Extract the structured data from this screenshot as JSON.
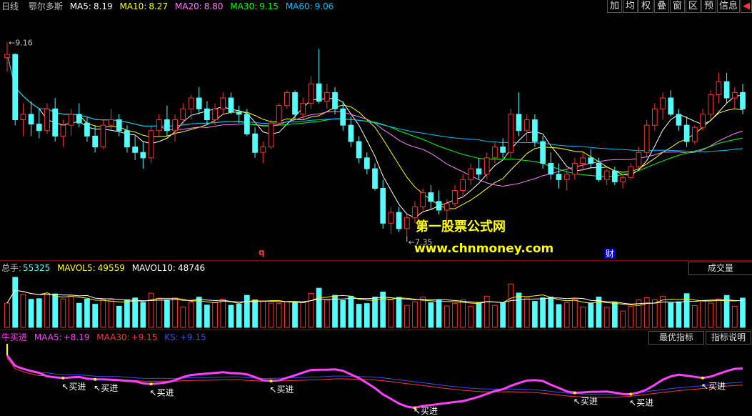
{
  "header": {
    "period": "日线",
    "stock_name": "鄂尔多斯",
    "ma5_label": "MA5:",
    "ma5": "8.19",
    "ma10_label": "MA10:",
    "ma10": "8.27",
    "ma20_label": "MA20:",
    "ma20": "8.80",
    "ma30_label": "MA30:",
    "ma30": "9.15",
    "ma60_label": "MA60:",
    "ma60": "9.06",
    "colors": {
      "ma5": "#ffffff",
      "ma10": "#ffff00",
      "ma20": "#ff80ff",
      "ma30": "#00ff00",
      "ma60": "#00c0ff"
    }
  },
  "toolbar": {
    "items": [
      "加",
      "均",
      "权",
      "叠",
      "窗",
      "区",
      "预",
      "信息"
    ],
    "arrow": "◀"
  },
  "watermark": {
    "line1": "第一股票公式网",
    "line2": "www.chnmoney.com"
  },
  "markers": {
    "q": "q",
    "cai": "财"
  },
  "volume_panel": {
    "total_label": "总手:",
    "total": "55325",
    "mavol5_label": "MAVOL5:",
    "mavol5": "49559",
    "mavol10_label": "MAVOL10:",
    "mavol10": "48746",
    "tab_label": "成交量"
  },
  "indicator_panel": {
    "name": "牛买进",
    "maa5_label": "MAA5:",
    "maa5": "+8.19",
    "maa30_label": "MAA30:",
    "maa30": "+9.15",
    "ks_label": "KS:",
    "ks": "+9.15",
    "btn_optimal": "最优指标",
    "btn_help": "指标说明",
    "signal_label": "买进"
  },
  "chart_data": {
    "type": "candlestick",
    "title": "鄂尔多斯 日线",
    "price_annotations": {
      "high": "9.16",
      "low": "7.35"
    },
    "colors": {
      "up": "#ff3232",
      "down": "#54fcfc",
      "signal": "#ffff00"
    },
    "candles": [
      [
        9.02,
        9.16,
        8.89,
        9.05
      ],
      [
        9.05,
        9.06,
        8.4,
        8.45
      ],
      [
        8.45,
        8.6,
        8.3,
        8.5
      ],
      [
        8.5,
        8.62,
        8.3,
        8.41
      ],
      [
        8.41,
        8.55,
        8.28,
        8.35
      ],
      [
        8.35,
        8.6,
        8.32,
        8.55
      ],
      [
        8.55,
        8.65,
        8.25,
        8.3
      ],
      [
        8.3,
        8.45,
        8.2,
        8.4
      ],
      [
        8.4,
        8.55,
        8.3,
        8.5
      ],
      [
        8.5,
        8.6,
        8.38,
        8.42
      ],
      [
        8.42,
        8.48,
        8.25,
        8.3
      ],
      [
        8.3,
        8.4,
        8.15,
        8.2
      ],
      [
        8.2,
        8.45,
        8.18,
        8.4
      ],
      [
        8.4,
        8.55,
        8.35,
        8.45
      ],
      [
        8.45,
        8.5,
        8.3,
        8.35
      ],
      [
        8.35,
        8.4,
        8.15,
        8.2
      ],
      [
        8.2,
        8.3,
        8.08,
        8.15
      ],
      [
        8.15,
        8.25,
        8.0,
        8.1
      ],
      [
        8.1,
        8.4,
        8.05,
        8.35
      ],
      [
        8.35,
        8.5,
        8.3,
        8.45
      ],
      [
        8.45,
        8.58,
        8.3,
        8.35
      ],
      [
        8.35,
        8.5,
        8.25,
        8.45
      ],
      [
        8.45,
        8.6,
        8.4,
        8.55
      ],
      [
        8.55,
        8.68,
        8.45,
        8.65
      ],
      [
        8.65,
        8.75,
        8.5,
        8.55
      ],
      [
        8.55,
        8.62,
        8.4,
        8.45
      ],
      [
        8.45,
        8.6,
        8.4,
        8.55
      ],
      [
        8.55,
        8.7,
        8.5,
        8.65
      ],
      [
        8.65,
        8.7,
        8.5,
        8.52
      ],
      [
        8.52,
        8.58,
        8.42,
        8.5
      ],
      [
        8.5,
        8.55,
        8.3,
        8.32
      ],
      [
        8.32,
        8.38,
        8.1,
        8.15
      ],
      [
        8.15,
        8.25,
        8.05,
        8.2
      ],
      [
        8.2,
        8.45,
        8.18,
        8.42
      ],
      [
        8.42,
        8.6,
        8.4,
        8.58
      ],
      [
        8.58,
        8.72,
        8.55,
        8.7
      ],
      [
        8.7,
        8.72,
        8.45,
        8.5
      ],
      [
        8.5,
        8.65,
        8.45,
        8.6
      ],
      [
        8.6,
        8.85,
        8.55,
        8.78
      ],
      [
        8.78,
        9.1,
        8.6,
        8.62
      ],
      [
        8.62,
        8.78,
        8.55,
        8.7
      ],
      [
        8.7,
        8.75,
        8.5,
        8.55
      ],
      [
        8.55,
        8.62,
        8.35,
        8.4
      ],
      [
        8.4,
        8.48,
        8.2,
        8.25
      ],
      [
        8.25,
        8.3,
        8.05,
        8.1
      ],
      [
        8.1,
        8.15,
        7.95,
        8.0
      ],
      [
        8.0,
        8.05,
        7.8,
        7.82
      ],
      [
        7.82,
        7.9,
        7.45,
        7.5
      ],
      [
        7.5,
        7.65,
        7.4,
        7.6
      ],
      [
        7.6,
        7.65,
        7.42,
        7.45
      ],
      [
        7.45,
        7.58,
        7.38,
        7.55
      ],
      [
        7.55,
        7.7,
        7.5,
        7.65
      ],
      [
        7.65,
        7.82,
        7.6,
        7.78
      ],
      [
        7.78,
        7.85,
        7.62,
        7.7
      ],
      [
        7.7,
        7.8,
        7.58,
        7.62
      ],
      [
        7.62,
        7.72,
        7.5,
        7.68
      ],
      [
        7.68,
        7.85,
        7.65,
        7.8
      ],
      [
        7.8,
        7.95,
        7.75,
        7.9
      ],
      [
        7.9,
        8.05,
        7.85,
        8.0
      ],
      [
        8.0,
        8.1,
        7.9,
        7.95
      ],
      [
        7.95,
        8.15,
        7.9,
        8.1
      ],
      [
        8.1,
        8.25,
        8.05,
        8.2
      ],
      [
        8.2,
        8.28,
        8.1,
        8.15
      ],
      [
        8.15,
        8.55,
        8.1,
        8.5
      ],
      [
        8.5,
        8.7,
        8.3,
        8.35
      ],
      [
        8.35,
        8.5,
        8.25,
        8.45
      ],
      [
        8.45,
        8.5,
        8.2,
        8.25
      ],
      [
        8.25,
        8.3,
        8.0,
        8.05
      ],
      [
        8.05,
        8.15,
        7.9,
        7.95
      ],
      [
        7.95,
        8.05,
        7.82,
        7.9
      ],
      [
        7.9,
        8.0,
        7.8,
        7.95
      ],
      [
        7.95,
        8.1,
        7.9,
        8.05
      ],
      [
        8.05,
        8.15,
        7.98,
        8.1
      ],
      [
        8.1,
        8.18,
        8.0,
        8.05
      ],
      [
        8.05,
        8.1,
        7.88,
        7.9
      ],
      [
        7.9,
        8.0,
        7.85,
        7.98
      ],
      [
        7.98,
        8.02,
        7.85,
        7.88
      ],
      [
        7.88,
        7.95,
        7.82,
        7.92
      ],
      [
        7.92,
        8.05,
        7.9,
        8.02
      ],
      [
        8.02,
        8.2,
        8.0,
        8.15
      ],
      [
        8.15,
        8.45,
        8.1,
        8.4
      ],
      [
        8.4,
        8.6,
        8.35,
        8.55
      ],
      [
        8.55,
        8.7,
        8.45,
        8.65
      ],
      [
        8.65,
        8.72,
        8.48,
        8.5
      ],
      [
        8.5,
        8.55,
        8.35,
        8.4
      ],
      [
        8.4,
        8.48,
        8.2,
        8.25
      ],
      [
        8.25,
        8.4,
        8.22,
        8.38
      ],
      [
        8.38,
        8.55,
        8.35,
        8.5
      ],
      [
        8.5,
        8.72,
        8.45,
        8.68
      ],
      [
        8.68,
        8.88,
        8.6,
        8.8
      ],
      [
        8.8,
        8.88,
        8.6,
        8.65
      ],
      [
        8.65,
        8.75,
        8.55,
        8.7
      ],
      [
        8.7,
        8.78,
        8.5,
        8.55
      ]
    ]
  }
}
